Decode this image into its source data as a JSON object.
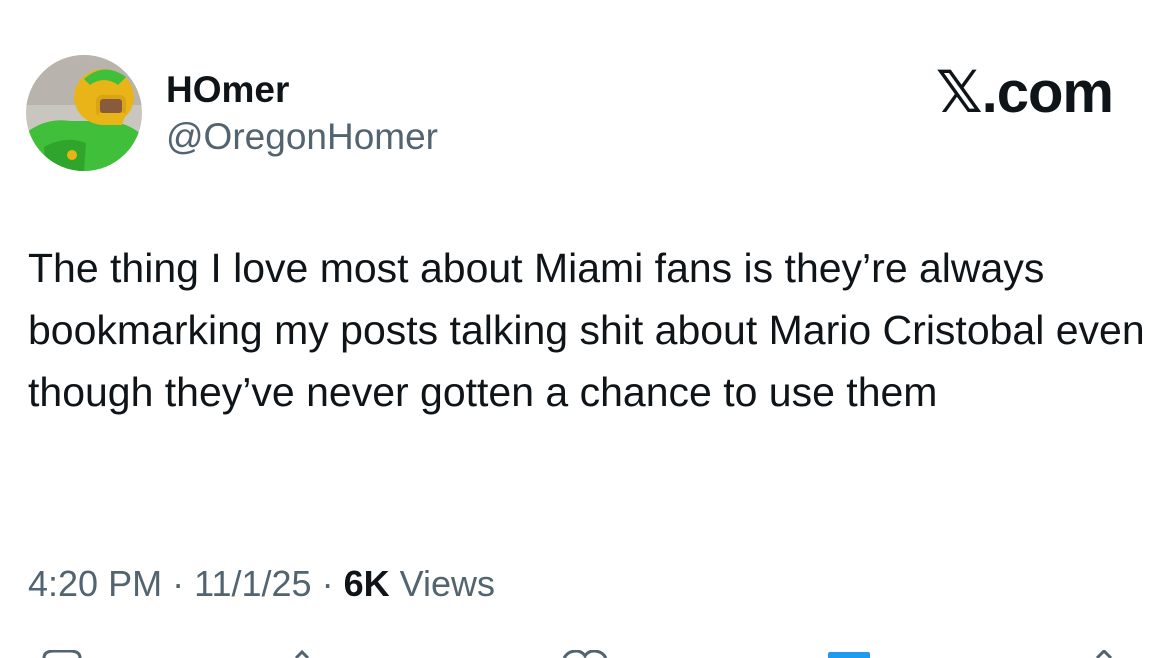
{
  "post": {
    "author": {
      "display_name": "HOmer",
      "handle": "@OregonHomer"
    },
    "brand": "𝕏.com",
    "text": "The thing I love most about Miami fans is they’re always bookmarking my posts talking shit about Mario Cristobal even though they’ve never gotten a chance to use them",
    "meta": {
      "time": "4:20 PM",
      "separator": "·",
      "date": "11/1/25",
      "views_count": "6K",
      "views_label": "Views"
    }
  },
  "actions": [
    "reply-icon",
    "repost-icon",
    "like-icon",
    "bookmark-icon",
    "share-icon"
  ],
  "colors": {
    "text": "#0f1419",
    "secondary": "#536471",
    "accent": "#1d9bf0",
    "avatar_jersey": "#3fbf3a",
    "avatar_helmet": "#e8b417"
  }
}
